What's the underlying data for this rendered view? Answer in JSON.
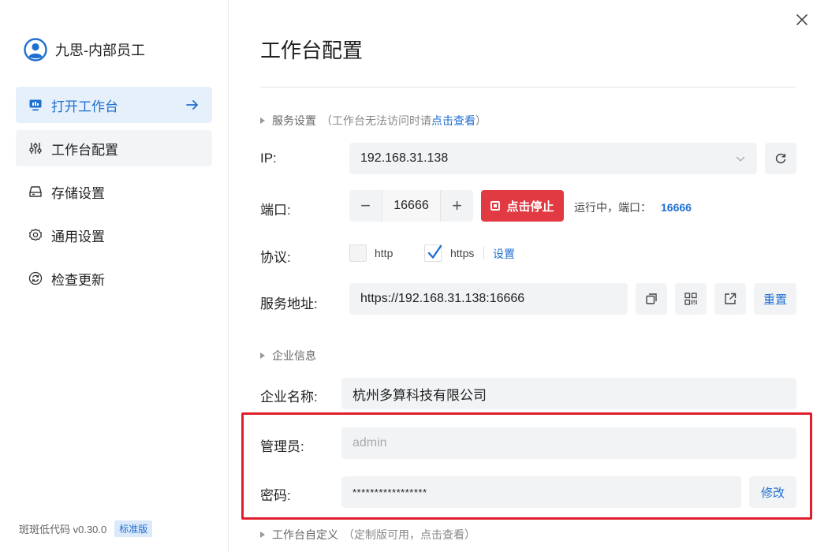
{
  "sidebar": {
    "user_name": "九思-内部员工",
    "items": [
      {
        "label": "打开工作台",
        "icon": "monitor-icon"
      },
      {
        "label": "工作台配置",
        "icon": "sliders-icon"
      },
      {
        "label": "存储设置",
        "icon": "drive-icon"
      },
      {
        "label": "通用设置",
        "icon": "gear-icon"
      },
      {
        "label": "检查更新",
        "icon": "refresh-icon"
      }
    ],
    "version": "斑斑低代码 v0.30.0",
    "edition_badge": "标准版"
  },
  "main": {
    "title": "工作台配置",
    "service_section": {
      "title": "服务设置",
      "hint_prefix": "（工作台无法访问时请",
      "hint_link": "点击查看",
      "hint_suffix": "）"
    },
    "ip": {
      "label": "IP:",
      "value": "192.168.31.138"
    },
    "port": {
      "label": "端口:",
      "value": "16666",
      "decrement": "−",
      "increment": "+"
    },
    "stop_button": "点击停止",
    "status": {
      "text": "运行中，端口：",
      "port": "16666"
    },
    "protocol": {
      "label": "协议:",
      "options": [
        {
          "label": "http",
          "checked": false
        },
        {
          "label": "https",
          "checked": true
        }
      ],
      "settings_link": "设置"
    },
    "service_address": {
      "label": "服务地址:",
      "value": "https://192.168.31.138:16666",
      "reset_button": "重置"
    },
    "enterprise_section": {
      "title": "企业信息"
    },
    "enterprise_name": {
      "label": "企业名称:",
      "value": "杭州多算科技有限公司"
    },
    "admin": {
      "label": "管理员:",
      "placeholder": "admin"
    },
    "password": {
      "label": "密码:",
      "value": "*****************",
      "edit_button": "修改"
    },
    "custom_section": {
      "title": "工作台自定义",
      "hint": "（定制版可用，点击查看）"
    }
  },
  "colors": {
    "accent": "#1f6fd0",
    "stop": "#e23a43",
    "highlight": "#e01e2b",
    "field_bg": "#f2f3f5"
  }
}
